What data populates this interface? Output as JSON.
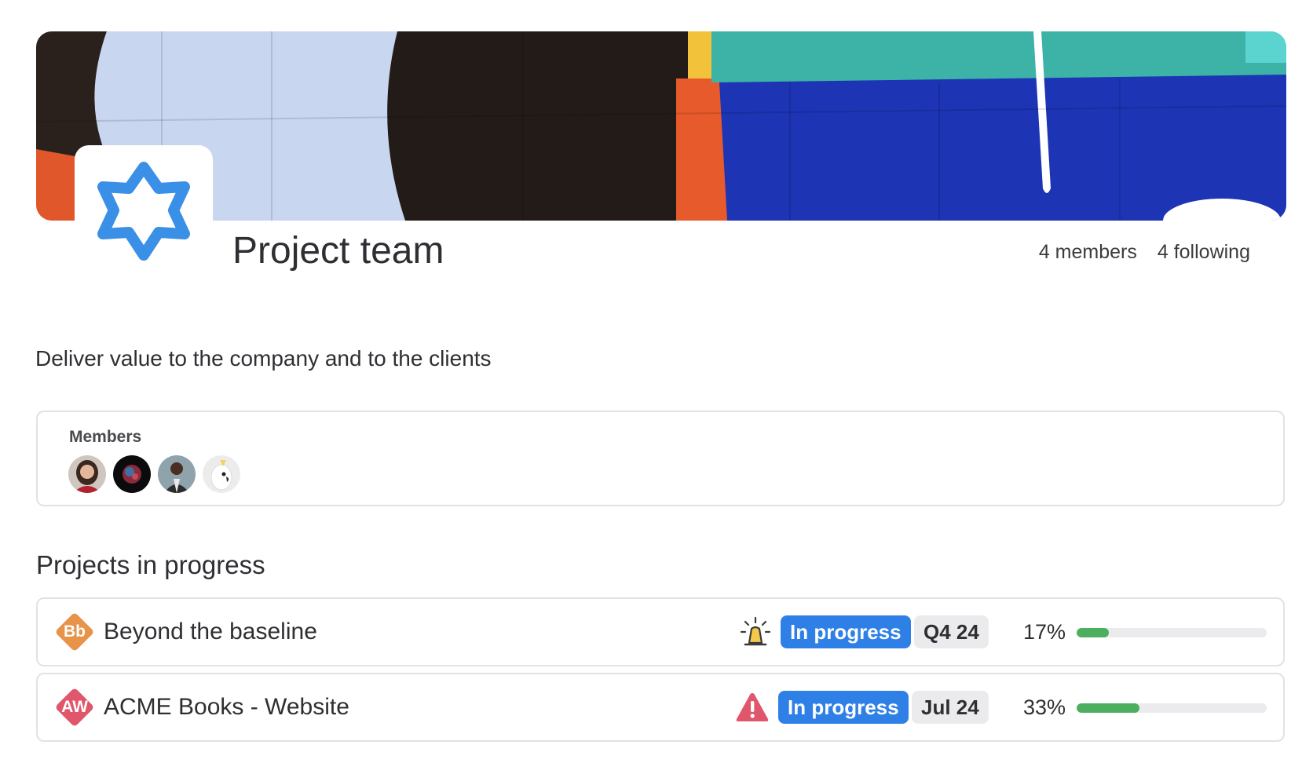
{
  "team": {
    "name": "Project team",
    "members_count_label": "4 members",
    "following_count_label": "4 following",
    "description": "Deliver value to the company and to the clients",
    "logo_icon": "star-of-david-outline-icon",
    "logo_color": "#3a8fe6"
  },
  "members": {
    "title": "Members",
    "avatars": [
      {
        "name": "avatar-woman-red-sweater"
      },
      {
        "name": "avatar-abstract-dark"
      },
      {
        "name": "avatar-man-patterned-shirt"
      },
      {
        "name": "avatar-cockatoo"
      }
    ]
  },
  "projects_section": {
    "title": "Projects in progress"
  },
  "projects": [
    {
      "initials": "Bb",
      "initials_color": "#e8934a",
      "name": "Beyond the baseline",
      "status_icon": "siren-alert-icon",
      "status": "In progress",
      "due": "Q4 24",
      "percent_label": "17%",
      "progress": 0.17
    },
    {
      "initials": "AW",
      "initials_color": "#e0566b",
      "name": "ACME Books - Website",
      "status_icon": "warning-triangle-icon",
      "status": "In progress",
      "due": "Jul 24",
      "percent_label": "33%",
      "progress": 0.33
    }
  ],
  "colors": {
    "status_pill": "#2f80e6",
    "progress_fill": "#4caf5f",
    "warning_red": "#e0566b",
    "siren_yellow": "#f2c94c"
  }
}
